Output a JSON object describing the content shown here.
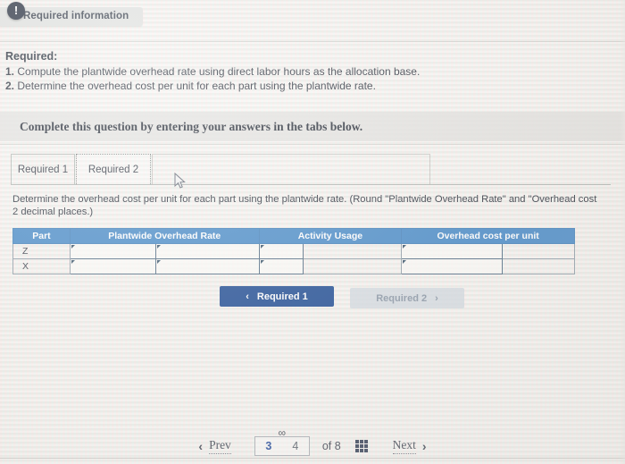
{
  "header": {
    "badge_glyph": "!",
    "badge_name": "exclamation-icon",
    "label": "Required information"
  },
  "requirements": {
    "title": "Required:",
    "items": [
      {
        "num": "1.",
        "text": "Compute the plantwide overhead rate using direct labor hours as the allocation base."
      },
      {
        "num": "2.",
        "text": "Determine the overhead cost per unit for each part using the plantwide rate."
      }
    ]
  },
  "complete_banner": {
    "text": "Complete this question by entering your answers in the tabs below."
  },
  "tabs": [
    {
      "label": "Required 1",
      "active": false
    },
    {
      "label": "Required 2",
      "active": true
    }
  ],
  "prompt": {
    "line1": "Determine the overhead cost per unit for each part using the plantwide rate. (Round \"Plantwide Overhead Rate\" and \"Overhead cost",
    "line2": "2 decimal places.)"
  },
  "answer_table": {
    "columns": [
      "Part",
      "Plantwide Overhead Rate",
      "Activity Usage",
      "Overhead cost per unit"
    ],
    "rows": [
      {
        "part": "Z",
        "rate_a": "",
        "rate_b": "",
        "activity_a": "",
        "activity_b": "",
        "cost_a": "",
        "cost_b": ""
      },
      {
        "part": "X",
        "rate_a": "",
        "rate_b": "",
        "activity_a": "",
        "activity_b": "",
        "cost_a": "",
        "cost_b": ""
      }
    ]
  },
  "nav_pills": {
    "prev": {
      "label": "Required 1",
      "chevron": "‹"
    },
    "next": {
      "label": "Required 2",
      "chevron": "›"
    }
  },
  "pager": {
    "prev_label": "Prev",
    "prev_chevron": "‹",
    "current_page": "3",
    "linked_page": "4",
    "link_icon_glyph": "∞",
    "of_text": "of 8",
    "grid_icon_name": "grid-icon",
    "next_label": "Next",
    "next_chevron": "›"
  },
  "colors": {
    "table_header_blue": "#4086c6",
    "pill_active_blue": "#14448f",
    "pill_disabled": "#cdd6de",
    "badge_dark": "#1c2536",
    "banner_gray": "#dedede"
  }
}
